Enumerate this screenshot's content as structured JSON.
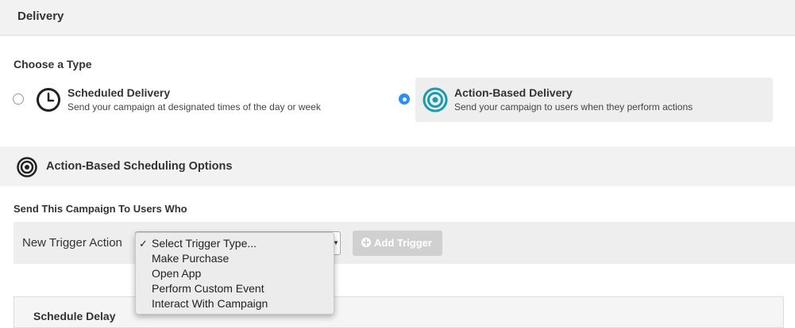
{
  "header": {
    "title": "Delivery"
  },
  "type_chooser": {
    "label": "Choose a Type",
    "options": [
      {
        "title": "Scheduled Delivery",
        "description": "Send your campaign at designated times of the day or week",
        "selected": false,
        "icon": "clock-icon"
      },
      {
        "title": "Action-Based Delivery",
        "description": "Send your campaign to users when they perform actions",
        "selected": true,
        "icon": "target-icon"
      }
    ]
  },
  "section": {
    "title": "Action-Based Scheduling Options",
    "icon": "target-icon"
  },
  "trigger": {
    "heading": "Send This Campaign To Users Who",
    "label": "New Trigger Action",
    "selected": "Select Trigger Type...",
    "options": [
      "Select Trigger Type...",
      "Make Purchase",
      "Open App",
      "Perform Custom Event",
      "Interact With Campaign"
    ],
    "add_button": "Add Trigger"
  },
  "schedule_delay": {
    "title": "Schedule Delay"
  },
  "colors": {
    "accent": "#2d8ff0",
    "target": "#1a9cb0",
    "disabled_button": "#d0d0d0"
  }
}
